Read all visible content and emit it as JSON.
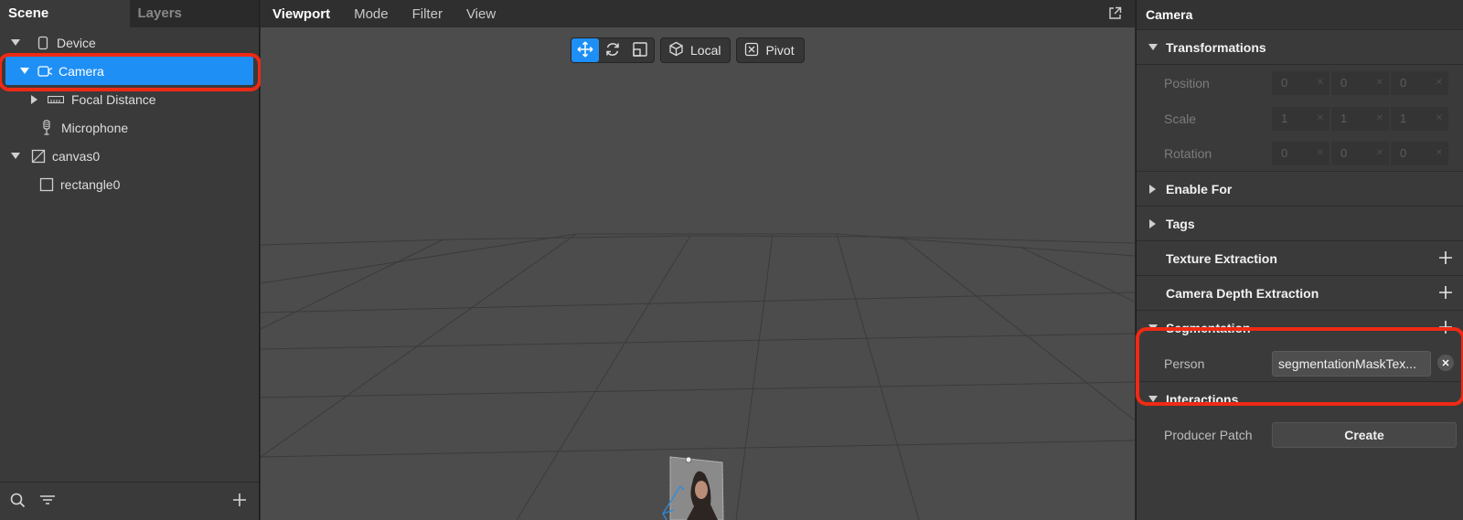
{
  "left": {
    "tabs": [
      "Scene",
      "Layers"
    ],
    "tree": [
      {
        "label": "Device",
        "icon": "device-icon"
      },
      {
        "label": "Camera",
        "icon": "camera-icon"
      },
      {
        "label": "Focal Distance",
        "icon": "ruler-icon"
      },
      {
        "label": "Microphone",
        "icon": "microphone-icon"
      },
      {
        "label": "canvas0",
        "icon": "canvas-icon"
      },
      {
        "label": "rectangle0",
        "icon": "rectangle-icon"
      }
    ]
  },
  "viewport": {
    "menus": [
      "Viewport",
      "Mode",
      "Filter",
      "View"
    ],
    "local_label": "Local",
    "pivot_label": "Pivot"
  },
  "inspector": {
    "title": "Camera",
    "sections": {
      "transformations": "Transformations",
      "enable_for": "Enable For",
      "tags": "Tags",
      "texture_extraction": "Texture Extraction",
      "camera_depth_extraction": "Camera Depth Extraction",
      "segmentation": "Segmentation",
      "interactions": "Interactions"
    },
    "position": {
      "label": "Position",
      "values": [
        "0",
        "0",
        "0"
      ]
    },
    "scale": {
      "label": "Scale",
      "values": [
        "1",
        "1",
        "1"
      ]
    },
    "rotation": {
      "label": "Rotation",
      "values": [
        "0",
        "0",
        "0"
      ]
    },
    "person": {
      "label": "Person",
      "value": "segmentationMaskTex..."
    },
    "producer_patch": {
      "label": "Producer Patch",
      "button": "Create"
    }
  },
  "colors": {
    "accent": "#1e8ff5",
    "highlight": "#ee2a15"
  }
}
